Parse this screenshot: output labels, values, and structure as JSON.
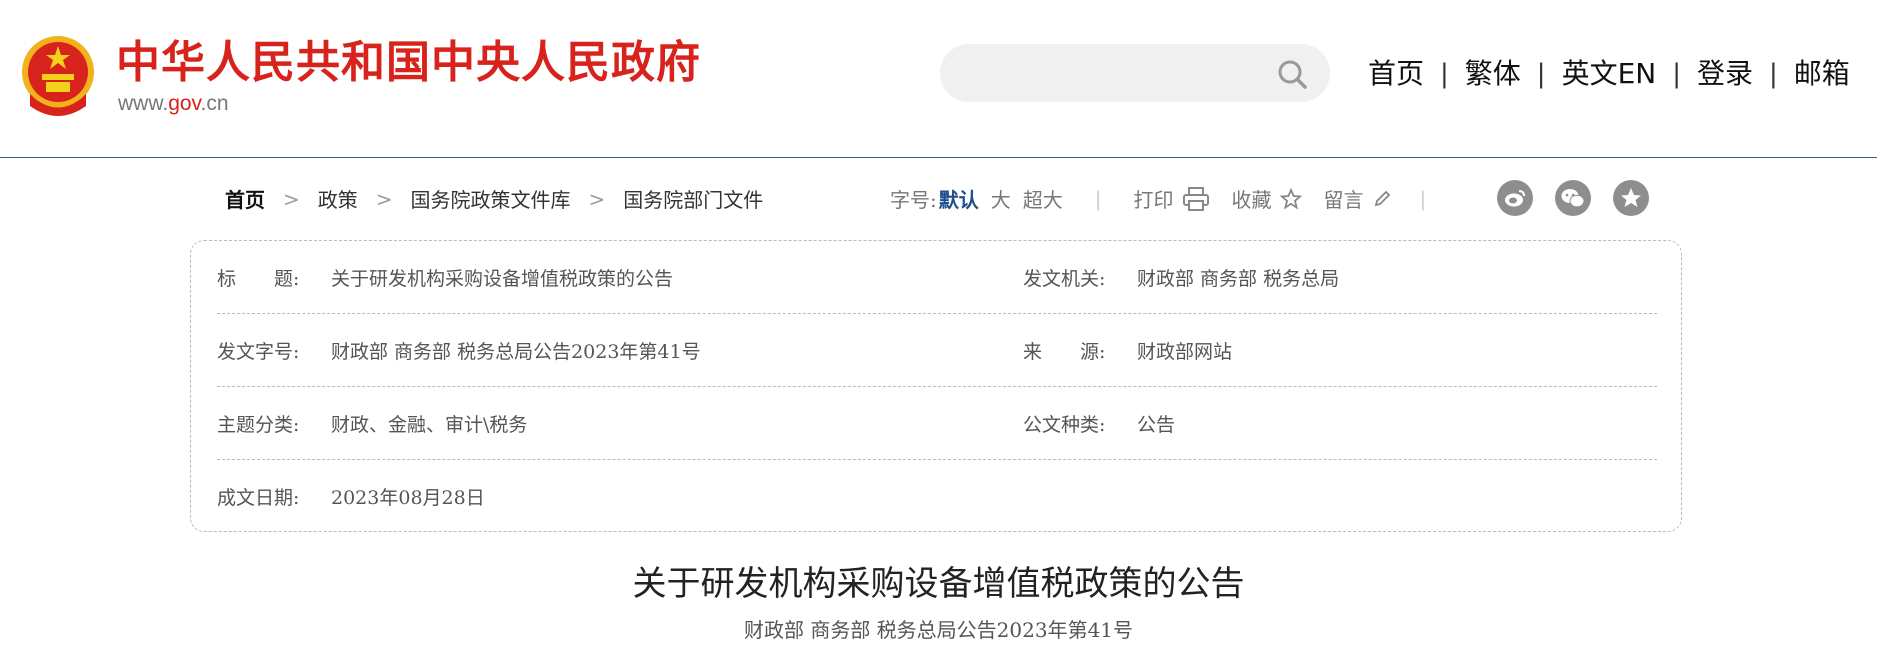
{
  "header": {
    "site_title": "中华人民共和国中央人民政府",
    "url_prefix": "www.",
    "url_gov": "gov",
    "url_suffix": ".cn",
    "search_placeholder": "",
    "nav": [
      "首页",
      "繁体",
      "英文EN",
      "登录",
      "邮箱"
    ],
    "nav_separator": "|"
  },
  "breadcrumb": {
    "items": [
      "首页",
      "政策",
      "国务院政策文件库",
      "国务院部门文件"
    ],
    "arrow": ">"
  },
  "tools": {
    "font_size_label": "字号:",
    "font_default": "默认",
    "font_large": "大",
    "font_xlarge": "超大",
    "print": "打印",
    "favorite": "收藏",
    "comment": "留言",
    "separator": "|"
  },
  "info": {
    "title_label": "标　　题:",
    "title_value": "关于研发机构采购设备增值税政策的公告",
    "issuer_label": "发文机关:",
    "issuer_value": "财政部 商务部 税务总局",
    "doc_no_label": "发文字号:",
    "doc_no_value": "财政部 商务部 税务总局公告2023年第41号",
    "source_label": "来　　源:",
    "source_value": "财政部网站",
    "topic_label": "主题分类:",
    "topic_value": "财政、金融、审计\\税务",
    "doc_type_label": "公文种类:",
    "doc_type_value": "公告",
    "date_label": "成文日期:",
    "date_value": "2023年08月28日"
  },
  "article": {
    "title": "关于研发机构采购设备增值税政策的公告",
    "subtitle": "财政部 商务部 税务总局公告2023年第41号"
  },
  "colors": {
    "brand_red": "#d8231c",
    "link_blue": "#1f4f8f",
    "header_border": "#3b5f86"
  }
}
